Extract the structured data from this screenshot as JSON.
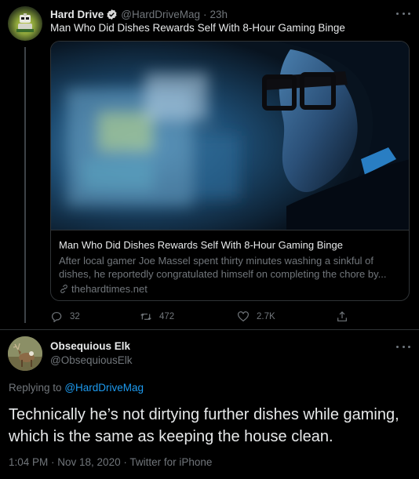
{
  "original_tweet": {
    "author_name": "Hard Drive",
    "author_handle": "@HardDriveMag",
    "time_sep": "·",
    "time_ago": "23h",
    "text": "Man Who Did Dishes Rewards Self With 8-Hour Gaming Binge",
    "card": {
      "title": "Man Who Did Dishes Rewards Self With 8-Hour Gaming Binge",
      "description_line1": "After local gamer Joe Massel spent thirty minutes washing a sinkful of",
      "description_line2": "dishes, he reportedly congratulated himself on completing the chore by...",
      "domain": "thehardtimes.net"
    },
    "actions": {
      "reply_count": "32",
      "retweet_count": "472",
      "like_count": "2.7K"
    }
  },
  "reply_tweet": {
    "author_name": "Obsequious Elk",
    "author_handle": "@ObsequiousElk",
    "replying_to_prefix": "Replying to",
    "replying_to_handle": "@HardDriveMag",
    "text": "Technically he’s not dirtying further dishes while gaming, which is the same as keeping the house clean.",
    "timestamp": "1:04 PM · Nov 18, 2020 · Twitter for iPhone"
  },
  "icons": [
    "verified-icon",
    "more-icon",
    "link-icon",
    "reply-icon",
    "retweet-icon",
    "like-icon",
    "share-icon"
  ],
  "colors": {
    "background": "#000000",
    "accent": "#1d9bf0",
    "text_primary": "#e7e9ea",
    "text_secondary": "#71767b",
    "border": "#2f3336"
  }
}
